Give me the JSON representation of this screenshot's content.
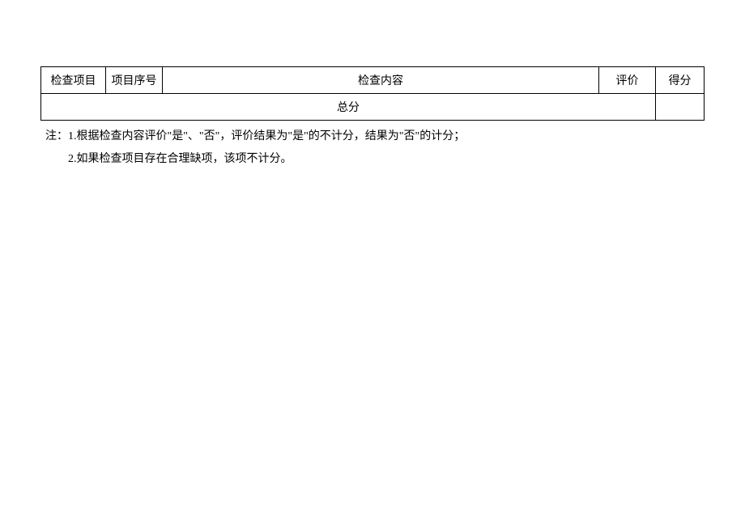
{
  "table": {
    "headers": {
      "check_item": "检查项目",
      "item_no": "项目序号",
      "content": "检查内容",
      "evaluation": "评价",
      "score": "得分"
    },
    "total_label": "总分",
    "total_value": ""
  },
  "notes": {
    "line1": "注：1.根据检查内容评价\"是\"、\"否\"，评价结果为\"是\"的不计分，结果为\"否\"的计分；",
    "line2": "2.如果检查项目存在合理缺项，该项不计分。"
  }
}
